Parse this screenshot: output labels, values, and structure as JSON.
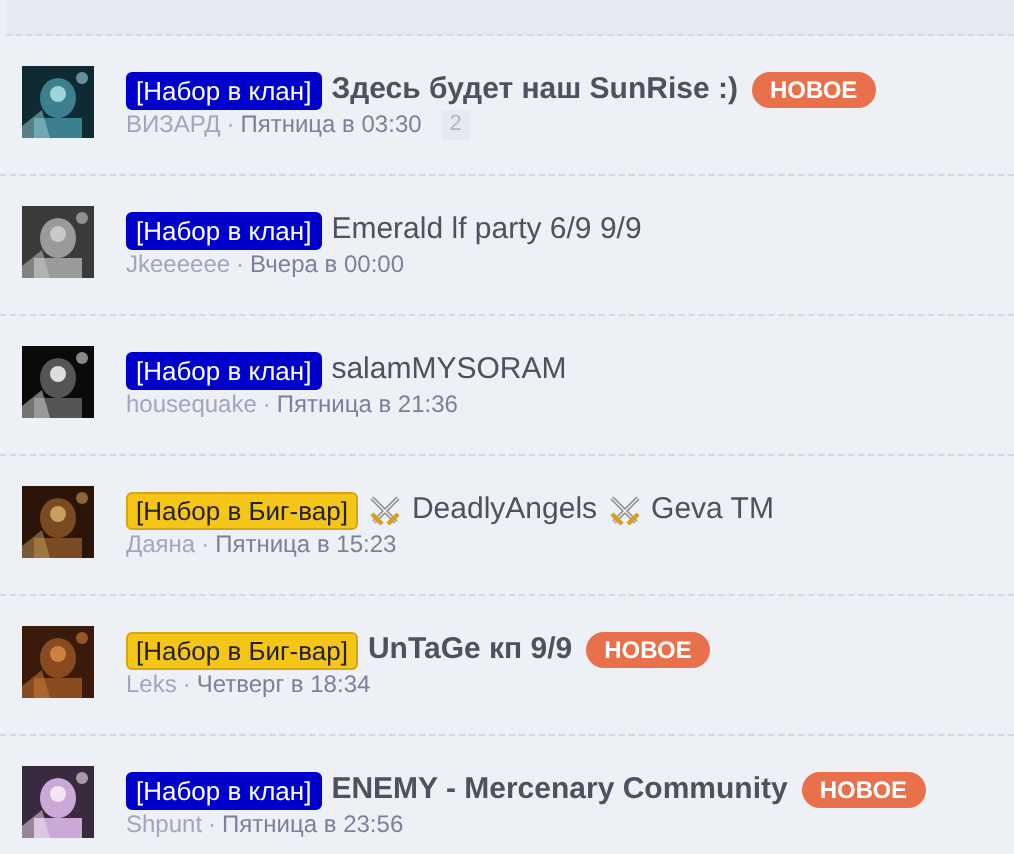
{
  "topics": [
    {
      "prefix": {
        "kind": "clan",
        "text": "[Набор в клан]"
      },
      "title": [
        {
          "kind": "text",
          "text": "Здесь будет наш SunRise :)"
        }
      ],
      "unread": true,
      "badge": "НОВОЕ",
      "author": "ВИЗАРД",
      "sep": "·",
      "date": "Пятница в 03:30",
      "replies": "2"
    },
    {
      "prefix": {
        "kind": "clan",
        "text": "[Набор в клан]"
      },
      "title": [
        {
          "kind": "text",
          "text": "Emerald lf party 6/9 9/9"
        }
      ],
      "unread": false,
      "author": "Jkeeeeee",
      "sep": "·",
      "date": "Вчера в 00:00"
    },
    {
      "prefix": {
        "kind": "clan",
        "text": "[Набор в клан]"
      },
      "title": [
        {
          "kind": "text",
          "text": "salamMYSORAM"
        }
      ],
      "unread": false,
      "author": "housequake",
      "sep": "·",
      "date": "Пятница в 21:36"
    },
    {
      "prefix": {
        "kind": "bigwar",
        "text": "[Набор в Биг-вар]"
      },
      "title": [
        {
          "kind": "icon"
        },
        {
          "kind": "text",
          "text": "DeadlyAngels"
        },
        {
          "kind": "icon"
        },
        {
          "kind": "text",
          "text": "Geva TM"
        }
      ],
      "unread": false,
      "author": "Даяна",
      "sep": "·",
      "date": "Пятница в 15:23"
    },
    {
      "prefix": {
        "kind": "bigwar",
        "text": "[Набор в Биг-вар]"
      },
      "title": [
        {
          "kind": "text",
          "text": "UnTaGe кп 9/9"
        }
      ],
      "unread": true,
      "badge": "НОВОЕ",
      "author": "Leks",
      "sep": "·",
      "date": "Четверг в 18:34"
    },
    {
      "prefix": {
        "kind": "clan",
        "text": "[Набор в клан]"
      },
      "title": [
        {
          "kind": "text",
          "text": "ENEMY - Mercenary Community"
        }
      ],
      "unread": true,
      "badge": "НОВОЕ",
      "author": "Shpunt",
      "sep": "·",
      "date": "Пятница в 23:56"
    }
  ]
}
